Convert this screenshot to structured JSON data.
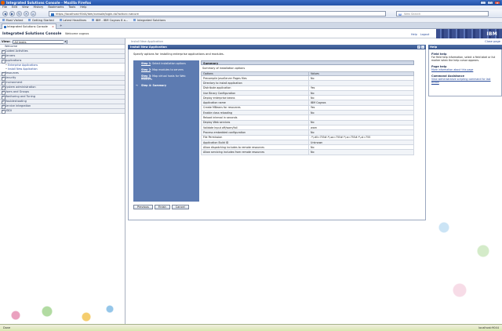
{
  "window": {
    "title": "Integrated Solutions Console - Mozilla Firefox",
    "controls": [
      "_",
      "□",
      "×"
    ]
  },
  "menubar": [
    "File",
    "Edit",
    "View",
    "History",
    "Bookmarks",
    "Tools",
    "Help"
  ],
  "nav": {
    "url": "https://localhost:9044/ibm/console/login.do?action=secure",
    "search_placeholder": "Web Search"
  },
  "bookmarks": [
    "Most Visited",
    "Getting Started",
    "Latest Headlines",
    "IBM - IBM Cognos 8 a...",
    "Integrated Solutions"
  ],
  "tab": {
    "label": "Integrated Solutions Console"
  },
  "header": {
    "title": "Integrated Solutions Console",
    "user": "Welcome cognos",
    "links": [
      "Help",
      "Logout"
    ],
    "logo": "IBM"
  },
  "leftnav": {
    "view_label": "View:",
    "view_value": "All tasks",
    "items": [
      {
        "label": "Welcome",
        "type": "plain"
      },
      {
        "label": "Guided Activities",
        "type": "closed"
      },
      {
        "label": "Servers",
        "type": "closed"
      },
      {
        "label": "Applications",
        "type": "open",
        "children": [
          "Enterprise Applications",
          "Install New Application"
        ]
      },
      {
        "label": "Resources",
        "type": "closed"
      },
      {
        "label": "Security",
        "type": "closed"
      },
      {
        "label": "Environment",
        "type": "closed"
      },
      {
        "label": "System administration",
        "type": "closed"
      },
      {
        "label": "Users and Groups",
        "type": "closed"
      },
      {
        "label": "Monitoring and Tuning",
        "type": "closed"
      },
      {
        "label": "Troubleshooting",
        "type": "closed"
      },
      {
        "label": "Service integration",
        "type": "closed"
      },
      {
        "label": "UDDI",
        "type": "closed"
      }
    ]
  },
  "main": {
    "breadcrumb": "Install New Application",
    "panel_title": "Install New Application",
    "panel_buttons": [
      "?",
      "-"
    ],
    "intro": "Specify options for installing enterprise applications and modules.",
    "steps": [
      {
        "num": "Step 1",
        "text": "Select installation options"
      },
      {
        "num": "Step 2",
        "text": "Map modules to servers"
      },
      {
        "num": "Step 3",
        "text": "Map virtual hosts for Web modules"
      },
      {
        "num": "Step 4",
        "text": "Summary",
        "current": true
      }
    ],
    "summary_title": "Summary",
    "summary_sub": "Summary of installation options",
    "columns": [
      "Options",
      "Values"
    ],
    "rows": [
      [
        "Precompile JavaServer Pages files",
        "No"
      ],
      [
        "Directory to install application",
        ""
      ],
      [
        "Distribute application",
        "Yes"
      ],
      [
        "Use Binary Configuration",
        "No"
      ],
      [
        "Deploy enterprise beans",
        "No"
      ],
      [
        "Application name",
        "IBM Cognos"
      ],
      [
        "Create MBeans for resources",
        "Yes"
      ],
      [
        "Enable class reloading",
        "No"
      ],
      [
        "Reload interval in seconds",
        ""
      ],
      [
        "Deploy Web services",
        "No"
      ],
      [
        "Validate Input off/warn/fail",
        "warn"
      ],
      [
        "Process embedded configuration",
        "No"
      ],
      [
        "File Permission",
        ".*\\.dll=755#.*\\.so=755#.*\\.a=755#.*\\.sl=755"
      ],
      [
        "Application Build ID",
        "Unknown"
      ],
      [
        "Allow dispatching includes to remote resources",
        "No"
      ],
      [
        "Allow servicing includes from remote resources",
        "No"
      ]
    ],
    "buttons": [
      "Previous",
      "Finish",
      "Cancel"
    ]
  },
  "help": {
    "close_page": "Close page",
    "title": "Help",
    "sections": [
      {
        "heading": "Field help",
        "text": "For field help information, select a field label or list marker when the help cursor appears."
      },
      {
        "heading": "Page help",
        "link": "More information about this page"
      },
      {
        "heading": "Command Assistance",
        "link": "View administrative scripting command for last action"
      }
    ]
  },
  "status": {
    "left": "Done",
    "right": "localhost:9044"
  }
}
